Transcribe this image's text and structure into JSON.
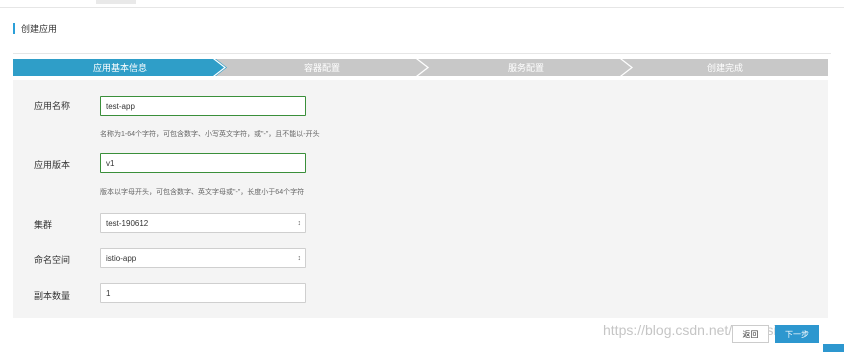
{
  "header": {
    "title": "创建应用"
  },
  "steps": [
    {
      "label": "应用基本信息",
      "active": true
    },
    {
      "label": "容器配置",
      "active": false
    },
    {
      "label": "服务配置",
      "active": false
    },
    {
      "label": "创建完成",
      "active": false
    }
  ],
  "form": {
    "app_name": {
      "label": "应用名称",
      "value": "test-app",
      "help": "名称为1-64个字符，可包含数字、小写英文字符，或\"-\"，且不能以-开头"
    },
    "app_version": {
      "label": "应用版本",
      "value": "v1",
      "help": "版本以字母开头，可包含数字、英文字母或\"-\"，长度小于64个字符"
    },
    "cluster": {
      "label": "集群",
      "value": "test-190612"
    },
    "namespace": {
      "label": "命名空间",
      "value": "istio-app"
    },
    "replicas": {
      "label": "副本数量",
      "value": "1"
    }
  },
  "footer": {
    "back_label": "返回",
    "next_label": "下一步"
  },
  "watermark": "https://blog.csdn.net/qq_insight",
  "colors": {
    "accent": "#2f9ec8",
    "inactive_step": "#c8c8c8",
    "valid_border": "#3a8f3a"
  },
  "icons": {
    "select_caret": "up-down-caret-icon"
  }
}
